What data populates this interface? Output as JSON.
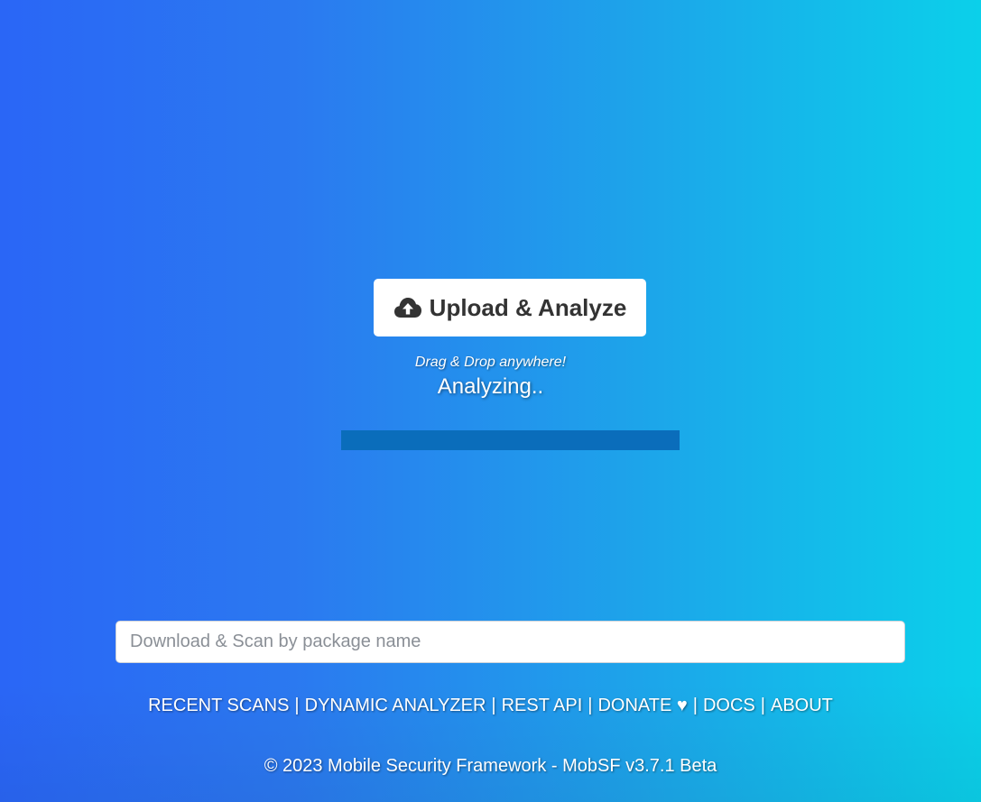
{
  "upload": {
    "button_label": "Upload & Analyze",
    "icon": "cloud-upload-icon",
    "drag_hint": "Drag & Drop anywhere!",
    "status": "Analyzing..",
    "progress_percent": 100,
    "progress_color": "#0a6dbb"
  },
  "package_search": {
    "placeholder": "Download & Scan by package name",
    "value": ""
  },
  "nav": {
    "recent_scans": "RECENT SCANS",
    "dynamic_analyzer": "DYNAMIC ANALYZER",
    "rest_api": "REST API",
    "donate": "DONATE ♥",
    "docs": "DOCS",
    "about": "ABOUT",
    "separator": "|"
  },
  "footer": {
    "copyright": "© 2023 Mobile Security Framework - MobSF v3.7.1 Beta"
  },
  "colors": {
    "gradient_start": "#2a66f6",
    "gradient_end": "#0bd0ea",
    "button_text": "#333333"
  }
}
